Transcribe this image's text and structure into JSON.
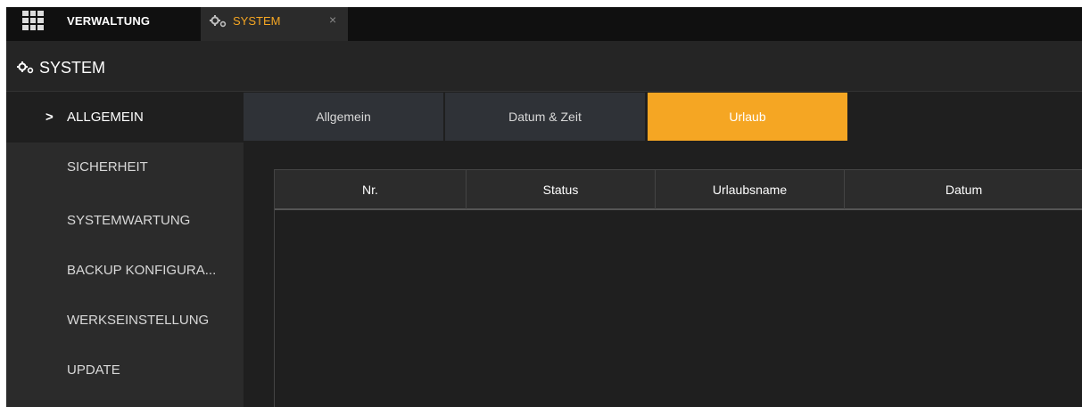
{
  "topbar": {
    "menu_icon": "grid-icon",
    "tab_management": "VERWALTUNG",
    "tab_system": "SYSTEM",
    "tab_system_icon": "gears-icon",
    "close_glyph": "×",
    "accent_color": "#f5a623"
  },
  "header": {
    "icon": "gears-icon",
    "title": "SYSTEM"
  },
  "sidebar": {
    "items": [
      {
        "label": "ALLGEMEIN",
        "active": true
      },
      {
        "label": "SICHERHEIT",
        "active": false
      },
      {
        "label": "SYSTEMWARTUNG",
        "active": false
      },
      {
        "label": "BACKUP KONFIGURA...",
        "active": false
      },
      {
        "label": "WERKSEINSTELLUNG",
        "active": false
      },
      {
        "label": "UPDATE",
        "active": false
      }
    ],
    "active_marker": ">"
  },
  "tabs": [
    {
      "label": "Allgemein",
      "active": false
    },
    {
      "label": "Datum & Zeit",
      "active": false
    },
    {
      "label": "Urlaub",
      "active": true
    }
  ],
  "table": {
    "columns": [
      "Nr.",
      "Status",
      "Urlaubsname",
      "Datum"
    ],
    "rows": []
  }
}
